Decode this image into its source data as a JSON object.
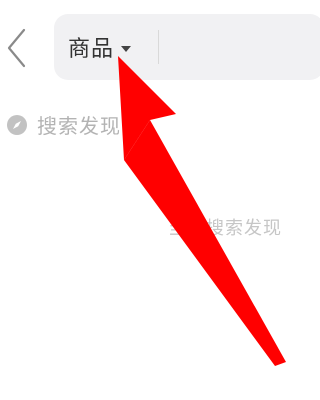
{
  "header": {
    "back_icon": "chevron-left-icon",
    "category_label": "商品",
    "caret_icon": "caret-down-icon",
    "search_value": ""
  },
  "discover": {
    "icon": "compass-icon",
    "label": "搜索发现"
  },
  "empty_state": {
    "text": "当前搜索发现"
  },
  "overlay": {
    "arrow_color": "#ff0000"
  }
}
